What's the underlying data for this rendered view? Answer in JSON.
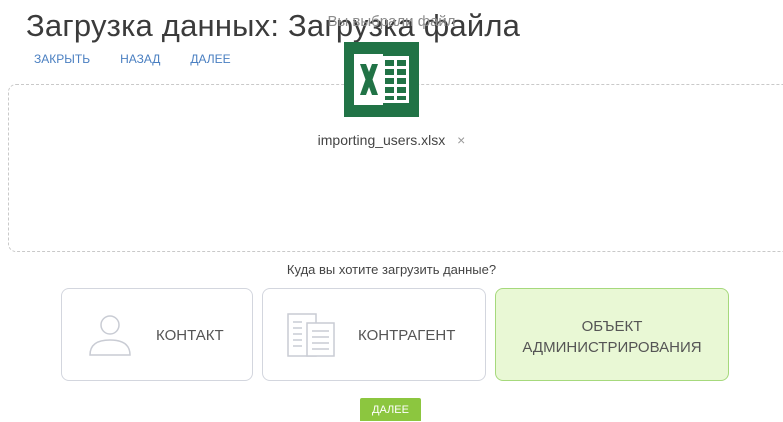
{
  "page": {
    "title": "Загрузка данных: Загрузка файла"
  },
  "toolbar": {
    "close_label": "ЗАКРЫТЬ",
    "back_label": "НАЗАД",
    "next_label": "ДАЛЕЕ"
  },
  "upload": {
    "heading": "Вы выбрали файл",
    "file_icon": "excel-file-icon",
    "file_name": "importing_users.xlsx",
    "remove_icon": "close-icon",
    "remove_glyph": "×"
  },
  "destination": {
    "question": "Куда вы хотите загрузить данные?",
    "options": [
      {
        "label": "КОНТАКТ",
        "icon": "person-icon",
        "selected": false
      },
      {
        "label": "КОНТРАГЕНТ",
        "icon": "document-icon",
        "selected": false
      },
      {
        "label": "ОБЪЕКТ АДМИНИСТРИРОВАНИЯ",
        "icon": "",
        "selected": true
      }
    ]
  },
  "footer": {
    "next_label": "ДАЛЕЕ"
  },
  "colors": {
    "accent_link": "#4a7fc1",
    "primary_button": "#8cc63f",
    "selected_bg": "#e9f8d5",
    "excel_green": "#217346"
  }
}
